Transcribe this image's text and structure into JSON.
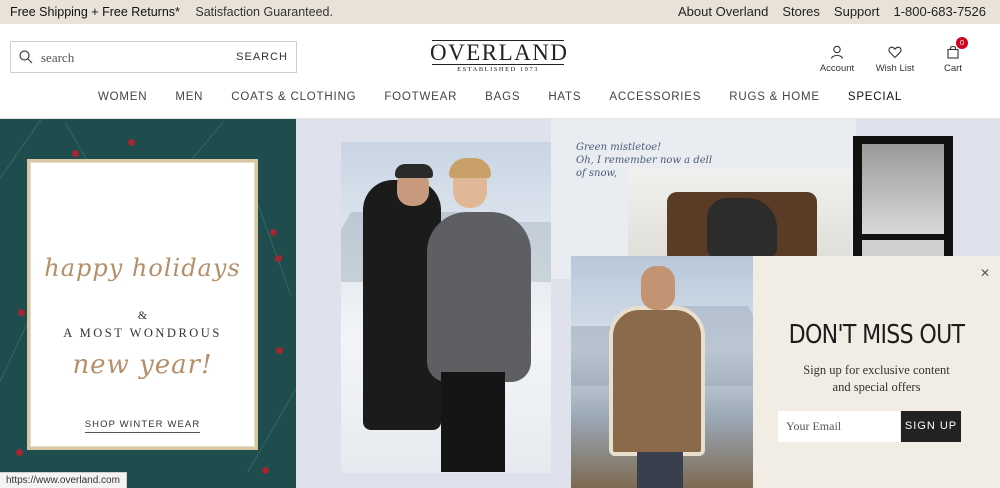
{
  "promo": {
    "shipping": "Free Shipping + Free Returns*",
    "satisfaction": "Satisfaction Guaranteed.",
    "links": [
      "About Overland",
      "Stores",
      "Support",
      "1-800-683-7526"
    ]
  },
  "search": {
    "placeholder": "search",
    "button": "SEARCH"
  },
  "logo": {
    "name": "OVERLAND",
    "tagline": "ESTABLISHED 1973"
  },
  "header_icons": {
    "account": "Account",
    "wishlist": "Wish List",
    "cart": "Cart",
    "cart_count": "0"
  },
  "nav": [
    "WOMEN",
    "MEN",
    "COATS & CLOTHING",
    "FOOTWEAR",
    "BAGS",
    "HATS",
    "ACCESSORIES",
    "RUGS & HOME",
    "SPECIAL"
  ],
  "holiday_card": {
    "line1": "happy holidays",
    "amp": "&",
    "line2": "A MOST WONDROUS",
    "line3": "new year!",
    "cta": "SHOP WINTER WEAR"
  },
  "note": {
    "line1": "Green mistletoe!",
    "line2": "Oh, I remember now a dell",
    "line3": "of snow,"
  },
  "popup": {
    "title": "DON'T MISS OUT",
    "subtitle_line1": "Sign up for exclusive content",
    "subtitle_line2": "and special offers",
    "email_placeholder": "Your Email",
    "button": "SIGN UP"
  },
  "status_bar": {
    "url": "https://www.overland.com"
  },
  "colors": {
    "promo_bg": "#e8e2d8",
    "green_panel": "#1f4d4d",
    "gold": "#b58f68",
    "popup_bg": "#f1ece4",
    "cart_badge": "#d0021b"
  }
}
